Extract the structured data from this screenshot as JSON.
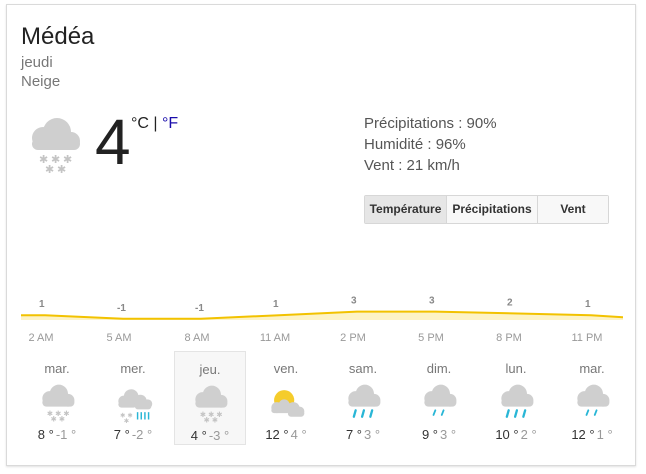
{
  "location": "Médéa",
  "day": "jeudi",
  "condition": "Neige",
  "current": {
    "temp": "4",
    "unit_c": "°C",
    "unit_sep": "|",
    "unit_f": "°F",
    "icon": "snow-cloud-icon"
  },
  "details": {
    "precip": "Précipitations : 90%",
    "humidity": "Humidité : 96%",
    "wind": "Vent : 21 km/h"
  },
  "tabs": [
    "Température",
    "Précipitations",
    "Vent"
  ],
  "active_tab": "Température",
  "colors": {
    "accent_line": "#f2c200",
    "accent_fill": "#fdf3c6",
    "link": "#1a0dab",
    "rain": "#29b6d6"
  },
  "chart_data": {
    "type": "area",
    "x": [
      "2 AM",
      "5 AM",
      "8 AM",
      "11 AM",
      "2 PM",
      "5 PM",
      "8 PM",
      "11 PM"
    ],
    "values": [
      1,
      -1,
      -1,
      1,
      3,
      3,
      2,
      1
    ],
    "labels": [
      "1",
      "-1",
      "-1",
      "1",
      "3",
      "3",
      "2",
      "1"
    ],
    "x_tick_labels": [
      "2 AM",
      "5 AM",
      "8 AM",
      "11 AM",
      "2 PM",
      "5 PM",
      "8 PM",
      "11 PM"
    ]
  },
  "forecast": [
    {
      "name": "mar.",
      "hi": "8 °",
      "lo": "-1 °",
      "icon": "snow-cloud-icon"
    },
    {
      "name": "mer.",
      "hi": "7 °",
      "lo": "-2 °",
      "icon": "snow-rain-cloud-icon"
    },
    {
      "name": "jeu.",
      "hi": "4 °",
      "lo": "-3 °",
      "icon": "snow-cloud-icon",
      "selected": true
    },
    {
      "name": "ven.",
      "hi": "12 °",
      "lo": "4 °",
      "icon": "partly-sunny-icon"
    },
    {
      "name": "sam.",
      "hi": "7 °",
      "lo": "3 °",
      "icon": "rain-cloud-icon"
    },
    {
      "name": "dim.",
      "hi": "9 °",
      "lo": "3 °",
      "icon": "light-rain-cloud-icon"
    },
    {
      "name": "lun.",
      "hi": "10 °",
      "lo": "2 °",
      "icon": "rain-cloud-icon"
    },
    {
      "name": "mar.",
      "hi": "12 °",
      "lo": "1 °",
      "icon": "light-rain-cloud-icon"
    }
  ]
}
